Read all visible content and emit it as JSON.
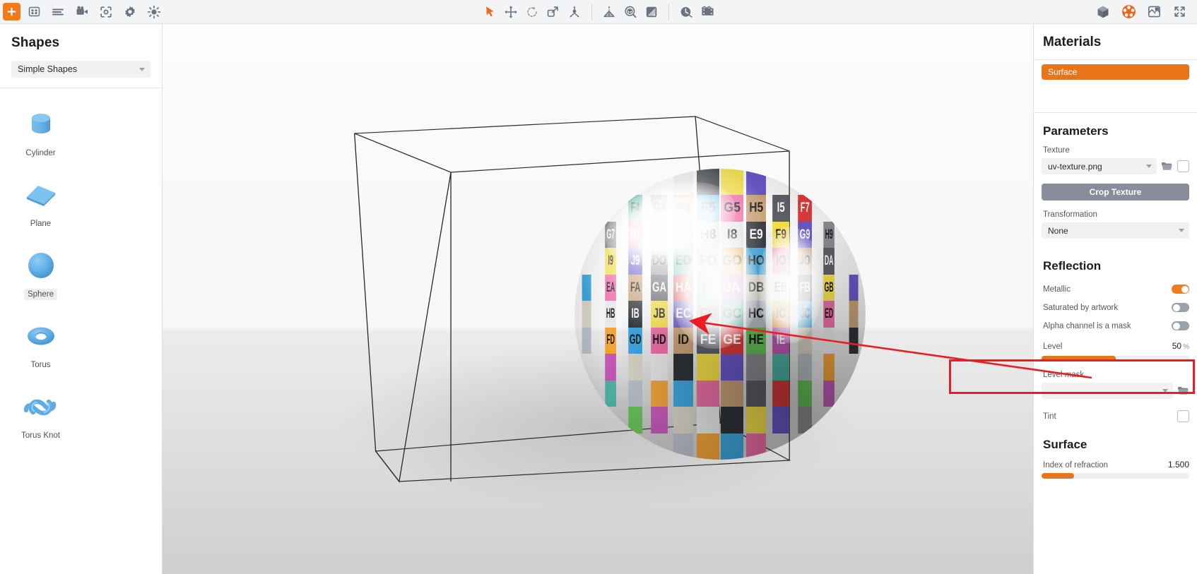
{
  "toolbar": {
    "left_icons": [
      {
        "name": "add-icon",
        "label": "Add"
      },
      {
        "name": "grid-icon",
        "label": "Grid"
      },
      {
        "name": "list-icon",
        "label": "List"
      },
      {
        "name": "camera-icon",
        "label": "Camera"
      },
      {
        "name": "focus-icon",
        "label": "Focus"
      },
      {
        "name": "gear-icon",
        "label": "Settings"
      },
      {
        "name": "light-icon",
        "label": "Light"
      }
    ],
    "center_icons": [
      {
        "name": "select-arrow-icon",
        "label": "Select",
        "active": true
      },
      {
        "name": "move-icon",
        "label": "Move"
      },
      {
        "name": "rotate-icon",
        "label": "Rotate"
      },
      {
        "name": "scale-icon",
        "label": "Scale"
      },
      {
        "name": "distribute-icon",
        "label": "Distribute"
      },
      {
        "name": "perspective-icon",
        "label": "Perspective"
      },
      {
        "name": "zoom-object-icon",
        "label": "Zoom to object"
      },
      {
        "name": "gradient-icon",
        "label": "Gradient"
      },
      {
        "name": "history-icon",
        "label": "History"
      },
      {
        "name": "animation-icon",
        "label": "Animation"
      }
    ],
    "right_icons": [
      {
        "name": "cube-icon",
        "label": "Cube"
      },
      {
        "name": "material-sphere-icon",
        "label": "Materials",
        "active": true
      },
      {
        "name": "render-icon",
        "label": "Render"
      },
      {
        "name": "fullscreen-icon",
        "label": "Fullscreen"
      }
    ]
  },
  "left_panel": {
    "title": "Shapes",
    "category": "Simple Shapes",
    "shapes": [
      {
        "label": "Cylinder",
        "icon": "cylinder-icon",
        "selected": false
      },
      {
        "label": "Plane",
        "icon": "plane-icon",
        "selected": false
      },
      {
        "label": "Sphere",
        "icon": "sphere-icon",
        "selected": true
      },
      {
        "label": "Torus",
        "icon": "torus-icon",
        "selected": false
      },
      {
        "label": "Torus Knot",
        "icon": "torus-knot-icon",
        "selected": false
      }
    ]
  },
  "right_panel": {
    "title": "Materials",
    "materials": [
      {
        "name": "Surface",
        "selected": true
      }
    ],
    "parameters": {
      "heading": "Parameters",
      "texture_label": "Texture",
      "texture_value": "uv-texture.png",
      "crop_button": "Crop Texture",
      "transformation_label": "Transformation",
      "transformation_value": "None"
    },
    "reflection": {
      "heading": "Reflection",
      "metallic_label": "Metallic",
      "metallic_on": true,
      "saturated_label": "Saturated by artwork",
      "saturated_on": false,
      "alpha_label": "Alpha channel is a mask",
      "alpha_on": false,
      "level_label": "Level",
      "level_value": "50",
      "level_unit": "%",
      "level_percent": 50,
      "level_mask_label": "Level mask",
      "level_mask_value": "",
      "tint_label": "Tint"
    },
    "surface": {
      "heading": "Surface",
      "ior_label": "Index of refraction",
      "ior_value": "1.500",
      "ior_percent": 22
    }
  },
  "viewport": {
    "object": "textured-sphere",
    "uv_labels": [
      "F4",
      "G4",
      "H4",
      "F5",
      "G5",
      "H5",
      "I5",
      "F7",
      "G7",
      "H7",
      "F8",
      "G8",
      "H8",
      "I8",
      "E9",
      "F9",
      "G9",
      "H9",
      "I9",
      "J9",
      "DO",
      "EO",
      "FO",
      "GO",
      "HO",
      "IO",
      "JO",
      "DA",
      "EA",
      "FA",
      "GA",
      "HA",
      "IA",
      "JA",
      "DB",
      "EB",
      "FB",
      "GB",
      "HB",
      "IB",
      "JB",
      "EC",
      "FC",
      "GC",
      "HC",
      "IC",
      "JC",
      "ED",
      "FD",
      "GD",
      "HD",
      "ID",
      "FE",
      "GE",
      "HE",
      "IE"
    ]
  },
  "annotation": {
    "type": "arrow-and-box",
    "color": "#ec1c24",
    "target": "reflection-level-slider"
  }
}
